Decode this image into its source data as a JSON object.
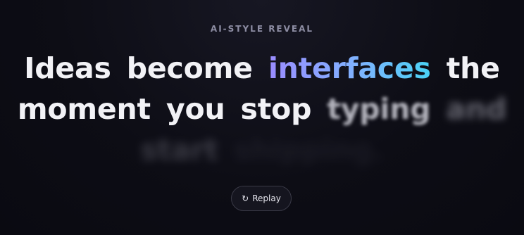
{
  "eyebrow": "AI-STYLE REVEAL",
  "headline": {
    "line1": [
      "Ideas",
      "become",
      "interfaces",
      "the"
    ],
    "line2": [
      "moment",
      "you",
      "stop",
      "typing",
      "and"
    ],
    "line3": [
      "start",
      "shipping."
    ]
  },
  "replay": {
    "icon": "↻",
    "label": "Replay"
  },
  "colors": {
    "background": "#0b0b12",
    "accent_start": "#9a8cff",
    "accent_end": "#49d3f5"
  }
}
